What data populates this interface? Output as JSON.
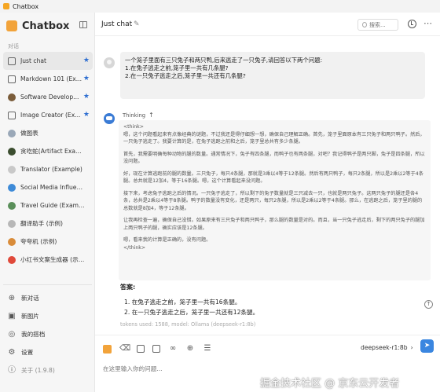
{
  "window": {
    "title": "Chatbox"
  },
  "sidebar": {
    "brand": "Chatbox",
    "section_label": "对话",
    "items": [
      {
        "label": "Just chat",
        "starred": true,
        "icon": "chat-icon"
      },
      {
        "label": "Markdown 101 (Ex...",
        "starred": true,
        "icon": "chat-icon"
      },
      {
        "label": "Software Develop...",
        "starred": true,
        "icon": "avatar-icon"
      },
      {
        "label": "Image Creator (Ex...",
        "starred": true,
        "icon": "chat-icon"
      },
      {
        "label": "做图表",
        "starred": false,
        "icon": "avatar-icon"
      },
      {
        "label": "贪吃蛇(Artifact Example)",
        "starred": false,
        "icon": "avatar-icon"
      },
      {
        "label": "Translator (Example)",
        "starred": false,
        "icon": "avatar-icon"
      },
      {
        "label": "Social Media Influencer ...",
        "starred": false,
        "icon": "avatar-icon"
      },
      {
        "label": "Travel Guide (Example)",
        "starred": false,
        "icon": "avatar-icon"
      },
      {
        "label": "翻译助手 (示例)",
        "starred": false,
        "icon": "avatar-icon"
      },
      {
        "label": "夸夸机 (示例)",
        "starred": false,
        "icon": "avatar-icon"
      },
      {
        "label": "小红书文案生成器 (示例)",
        "starred": false,
        "icon": "avatar-icon"
      }
    ],
    "bottom": {
      "new_chat": "新对话",
      "new_image": "新图片",
      "my_partners": "我的搭档",
      "settings": "设置",
      "about": "关于 (1.9.8)"
    }
  },
  "header": {
    "title": "Just chat",
    "search_placeholder": "搜索..."
  },
  "user_message": {
    "lines": [
      "一个笼子里面有三只兔子和两只鸭,后来逃走了一只兔子,请回答以下两个问题:",
      "1.在兔子逃走之前,笼子里一共有几条腿?",
      "2.在一只兔子逃走之后,笼子里一共还有几条腿?"
    ]
  },
  "assistant": {
    "thinking_label": "Thinking",
    "think_paragraphs": [
      "<think>",
      "嗯，这个问题看起来有点像经典的谜题，不过我还是得仔细想一想，确保自己理解正确。首先，笼子里面原本有三只兔子和两只鸭子。然后，一只兔子逃走了。我要计算的是，在兔子逃跑之前和之后，笼子里总共有多少条腿。",
      "首先，我需要明确每种动物的腿的数量。通常情况下，兔子有四条腿，而鸭子也有两条腿，对吧？我记得鸭子是两只脚，兔子是四条腿，所以没问题。",
      "好，现在计算逃跑前的腿的数量。三只兔子，每只4条腿，那就是3乘以4等于12条腿。然后有两只鸭子，每只2条腿，所以是2乘以2等于4条腿。总共就是12加4，等于16条腿。嗯，这个计算看起来没问题。",
      "接下来，考虑兔子逃跑之后的情况。一只兔子逃走了，所以剩下的兔子数量就是三只减去一只，也就是两只兔子。这两只兔子的腿还是各4条，总共是2乘以4等于8条腿。鸭子的数量没有变化，还是两只，每只2条腿，所以是2乘以2等于4条腿。那么，在逃跑之后，笼子里的腿的总数就是8加4，等于12条腿。",
      "让我再检查一遍，确保自己没错。如果原来有三只兔子和两只鸭子，那么腿的数量是对的。而且，当一只兔子逃走后，剩下的两只兔子的腿加上两只鸭子的腿，确实应该是12条腿。",
      "嗯，看来我的计算是正确的，没有问题。",
      "</think>"
    ],
    "answer_title": "答案:",
    "answer_lines": [
      "1. 在兔子逃走之前，笼子里一共有16条腿。",
      "2. 在一只兔子逃走之后，笼子里一共还有12条腿。"
    ],
    "tokens_info": "tokens used: 1588, model: Ollama (deepseek-r1:8b)"
  },
  "composer": {
    "model": "deepseek-r1:8b",
    "placeholder": "在这里输入你的问题..."
  },
  "watermark": "掘金技术社区 @ 京东云开发者",
  "colors": {
    "accent": "#3a86e0",
    "brand": "#f2a33a",
    "star": "#2f6fd1"
  }
}
